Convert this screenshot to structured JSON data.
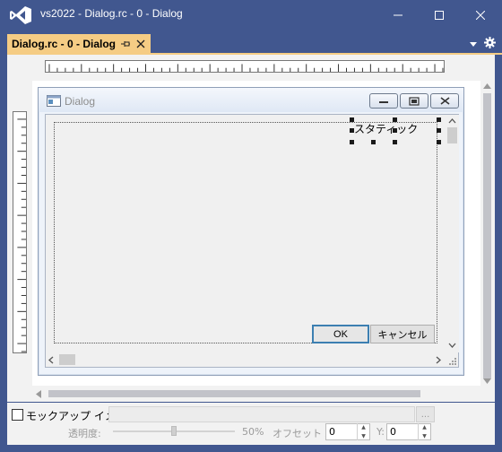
{
  "window": {
    "title": "vs2022 - Dialog.rc - 0 - Dialog",
    "app_icon": "visual-studio-logo",
    "controls": [
      "minimize-icon",
      "maximize-icon",
      "close-icon"
    ]
  },
  "document_tab": {
    "label": "Dialog.rc - 0 - Dialog",
    "pin_icon": "pin-icon",
    "close_icon": "close-icon",
    "accent_color": "#f5cc84"
  },
  "tab_strip": {
    "icons": [
      "dropdown-arrow-icon",
      "gear-icon"
    ]
  },
  "dialog": {
    "title": "Dialog",
    "caption_buttons": [
      "minimize-icon",
      "restore-icon",
      "close-icon"
    ],
    "static_label": "スタティック",
    "ok_label": "OK",
    "cancel_label": "キャンセル"
  },
  "mockup_panel": {
    "checkbox_label": "モックアップ イメージ",
    "checkbox_checked": false,
    "path_value": "",
    "browse_label": "...",
    "opacity_label": "透明度:",
    "opacity_percent": "50%",
    "offset_label": "オフセット X:",
    "offset_x": "0",
    "y_label": "Y:",
    "offset_y": "0"
  },
  "colors": {
    "chrome": "#41578f",
    "accent": "#f5cc84",
    "focus_border": "#3c7fb1"
  }
}
